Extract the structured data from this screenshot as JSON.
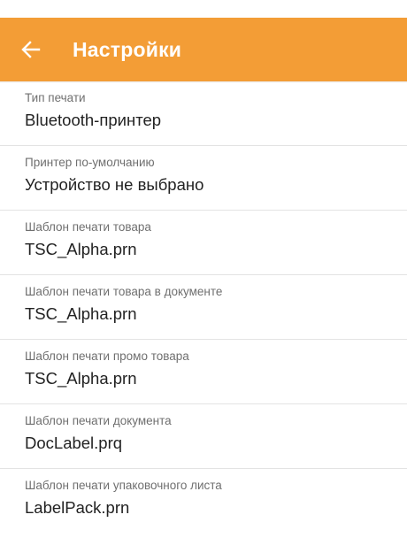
{
  "header": {
    "title": "Настройки",
    "back_icon": "arrow-left-icon",
    "accent_color": "#f39d36"
  },
  "settings": [
    {
      "label": "Тип печати",
      "value": "Bluetooth-принтер"
    },
    {
      "label": "Принтер по-умолчанию",
      "value": "Устройство не выбрано"
    },
    {
      "label": "Шаблон печати товара",
      "value": "TSC_Alpha.prn"
    },
    {
      "label": "Шаблон печати товара в документе",
      "value": "TSC_Alpha.prn"
    },
    {
      "label": "Шаблон печати промо товара",
      "value": "TSC_Alpha.prn"
    },
    {
      "label": "Шаблон печати документа",
      "value": "DocLabel.prq"
    },
    {
      "label": "Шаблон печати упаковочного листа",
      "value": "LabelPack.prn"
    }
  ]
}
